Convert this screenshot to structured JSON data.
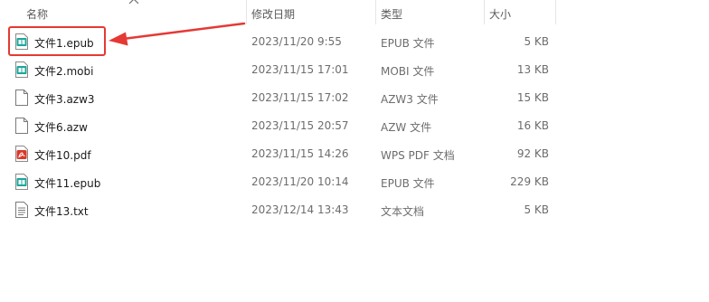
{
  "columns": {
    "name": "名称",
    "date": "修改日期",
    "type": "类型",
    "size": "大小"
  },
  "files": [
    {
      "name": "文件1.epub",
      "date": "2023/11/20 9:55",
      "type": "EPUB 文件",
      "size": "5 KB",
      "icon": "epub-file-icon"
    },
    {
      "name": "文件2.mobi",
      "date": "2023/11/15 17:01",
      "type": "MOBI 文件",
      "size": "13 KB",
      "icon": "mobi-file-icon"
    },
    {
      "name": "文件3.azw3",
      "date": "2023/11/15 17:02",
      "type": "AZW3 文件",
      "size": "15 KB",
      "icon": "blank-file-icon"
    },
    {
      "name": "文件6.azw",
      "date": "2023/11/15 20:57",
      "type": "AZW 文件",
      "size": "16 KB",
      "icon": "blank-file-icon"
    },
    {
      "name": "文件10.pdf",
      "date": "2023/11/15 14:26",
      "type": "WPS PDF 文档",
      "size": "92 KB",
      "icon": "pdf-file-icon"
    },
    {
      "name": "文件11.epub",
      "date": "2023/11/20 10:14",
      "type": "EPUB 文件",
      "size": "229 KB",
      "icon": "epub-file-icon"
    },
    {
      "name": "文件13.txt",
      "date": "2023/12/14 13:43",
      "type": "文本文档",
      "size": "5 KB",
      "icon": "text-file-icon"
    }
  ],
  "colors": {
    "annotation": "#e53935",
    "ebook_icon": "#1aa79a",
    "pdf_icon": "#d93a2b"
  }
}
